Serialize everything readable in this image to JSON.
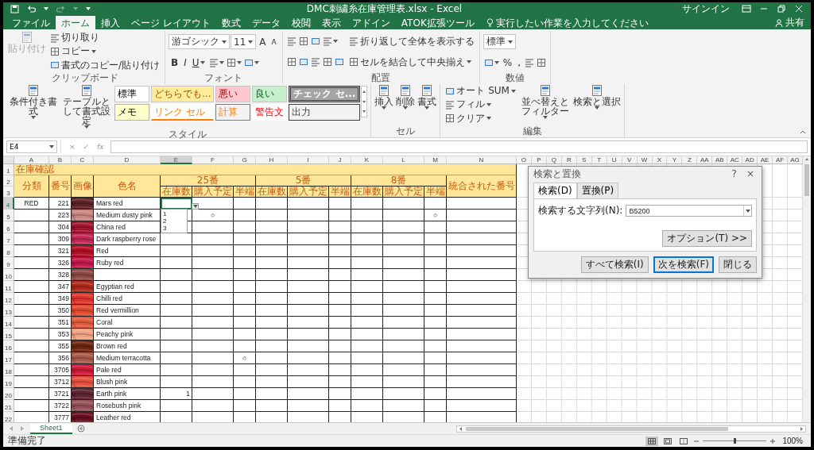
{
  "window": {
    "title": "DMC刺繍糸在庫管理表.xlsx - Excel",
    "sign_in": "サインイン",
    "share": "共有"
  },
  "tabs": [
    {
      "label": "ファイル",
      "selected": false
    },
    {
      "label": "ホーム",
      "selected": true
    },
    {
      "label": "挿入",
      "selected": false
    },
    {
      "label": "ページ レイアウト",
      "selected": false
    },
    {
      "label": "数式",
      "selected": false
    },
    {
      "label": "データ",
      "selected": false
    },
    {
      "label": "校閲",
      "selected": false
    },
    {
      "label": "表示",
      "selected": false
    },
    {
      "label": "アドイン",
      "selected": false
    },
    {
      "label": "ATOK拡張ツール",
      "selected": false
    }
  ],
  "tell_me": {
    "placeholder": "実行したい作業を入力してください"
  },
  "ribbon": {
    "groups": [
      {
        "label": "クリップボード",
        "columns": [
          {
            "kind": "big",
            "label": "貼り付け",
            "disabled": true
          },
          {
            "kind": "stack",
            "rows": [
              {
                "controls": [
                  {
                    "kind": "small",
                    "label": "切り取り"
                  }
                ]
              },
              {
                "controls": [
                  {
                    "kind": "small",
                    "label": "コピー",
                    "dropdown": true
                  }
                ]
              },
              {
                "controls": [
                  {
                    "kind": "small",
                    "label": "書式のコピー/貼り付け"
                  }
                ]
              }
            ]
          }
        ]
      },
      {
        "label": "フォント",
        "columns": [
          {
            "kind": "stack",
            "rows": [
              {
                "controls": [
                  {
                    "kind": "field",
                    "value": "游ゴシック"
                  },
                  {
                    "kind": "field",
                    "value": "11"
                  },
                  {
                    "kind": "text",
                    "label": "A"
                  },
                  {
                    "kind": "small-text",
                    "label": "A"
                  }
                ]
              },
              {
                "controls": [
                  {
                    "kind": "bold",
                    "label": "B"
                  },
                  {
                    "kind": "italic",
                    "label": "I"
                  },
                  {
                    "kind": "underline",
                    "label": "U",
                    "dropdown": true
                  },
                  {
                    "kind": "icon",
                    "dropdown": true
                  },
                  {
                    "kind": "icon",
                    "dropdown": true
                  },
                  {
                    "kind": "icon",
                    "dropdown": true
                  }
                ]
              }
            ]
          }
        ]
      },
      {
        "label": "配置",
        "columns": [
          {
            "kind": "stack",
            "rows": [
              {
                "controls": [
                  {
                    "kind": "icon"
                  },
                  {
                    "kind": "icon"
                  },
                  {
                    "kind": "icon"
                  },
                  {
                    "kind": "icon",
                    "dropdown": true
                  }
                ]
              },
              {
                "controls": [
                  {
                    "kind": "icon"
                  },
                  {
                    "kind": "icon"
                  },
                  {
                    "kind": "icon"
                  },
                  {
                    "kind": "icon"
                  },
                  {
                    "kind": "icon"
                  }
                ]
              }
            ]
          },
          {
            "kind": "stack",
            "rows": [
              {
                "controls": [
                  {
                    "kind": "small",
                    "label": "折り返して全体を表示する"
                  }
                ]
              },
              {
                "controls": [
                  {
                    "kind": "small",
                    "label": "セルを結合して中央揃え",
                    "dropdown": true
                  }
                ]
              }
            ]
          }
        ]
      },
      {
        "label": "数値",
        "columns": [
          {
            "kind": "stack",
            "rows": [
              {
                "controls": [
                  {
                    "kind": "field",
                    "value": "標準"
                  }
                ]
              },
              {
                "controls": [
                  {
                    "kind": "icon",
                    "dropdown": true
                  },
                  {
                    "kind": "text",
                    "label": "%"
                  },
                  {
                    "kind": "text",
                    "label": ","
                  },
                  {
                    "kind": "icon"
                  },
                  {
                    "kind": "icon"
                  }
                ]
              }
            ]
          }
        ]
      },
      {
        "label": "スタイル",
        "columns": [
          {
            "kind": "big",
            "label": "条件付き書式",
            "dropdown": true
          },
          {
            "kind": "big",
            "label": "テーブルとして書式設定",
            "dropdown": true
          },
          {
            "kind": "gallery",
            "cells": [
              {
                "kind": "normal",
                "label": "標準",
                "color": "#ffffff"
              },
              {
                "kind": "neutral",
                "label": "どちらでも...",
                "color": "#ffeb9c"
              },
              {
                "kind": "bad",
                "label": "悪い",
                "color": "#ffc7ce"
              },
              {
                "kind": "good",
                "label": "良い",
                "color": "#c6efce"
              },
              {
                "kind": "check",
                "label": "チェック セ...",
                "color": "#a5a5a5"
              },
              {
                "kind": "note",
                "label": "メモ",
                "color": "#ffffcc"
              },
              {
                "kind": "link",
                "label": "リンク セル",
                "color": "#ffffff"
              },
              {
                "kind": "calc",
                "label": "計算",
                "color": "#f2f2f2"
              },
              {
                "kind": "warning",
                "label": "警告文",
                "color": "#ffffff"
              },
              {
                "kind": "output",
                "label": "出力",
                "color": "#f2f2f2"
              }
            ]
          }
        ]
      },
      {
        "label": "セル",
        "columns": [
          {
            "kind": "big",
            "label": "挿入",
            "dropdown": true
          },
          {
            "kind": "big",
            "label": "削除",
            "dropdown": true
          },
          {
            "kind": "big",
            "label": "書式",
            "dropdown": true
          }
        ]
      },
      {
        "label": "編集",
        "columns": [
          {
            "kind": "stack",
            "rows": [
              {
                "controls": [
                  {
                    "kind": "small",
                    "label": "オート SUM",
                    "dropdown": true
                  }
                ]
              },
              {
                "controls": [
                  {
                    "kind": "small",
                    "label": "フィル",
                    "dropdown": true
                  }
                ]
              },
              {
                "controls": [
                  {
                    "kind": "small",
                    "label": "クリア",
                    "dropdown": true
                  }
                ]
              }
            ]
          },
          {
            "kind": "big",
            "label": "並べ替えとフィルター",
            "dropdown": true
          },
          {
            "kind": "big",
            "label": "検索と選択",
            "dropdown": true
          }
        ]
      }
    ]
  },
  "formula_bar": {
    "name_box": "E4",
    "buttons": [
      "×",
      "✓",
      "fx"
    ]
  },
  "sheet": {
    "columns": [
      {
        "label": "A",
        "selected": false
      },
      {
        "label": "B",
        "selected": false
      },
      {
        "label": "C",
        "selected": false
      },
      {
        "label": "D",
        "selected": false
      },
      {
        "label": "E",
        "selected": true
      },
      {
        "label": "F",
        "selected": false
      },
      {
        "label": "G",
        "selected": false
      },
      {
        "label": "H",
        "selected": false
      },
      {
        "label": "I",
        "selected": false
      },
      {
        "label": "J",
        "selected": false
      },
      {
        "label": "K",
        "selected": false
      },
      {
        "label": "L",
        "selected": false
      },
      {
        "label": "M",
        "selected": false
      },
      {
        "label": "N",
        "selected": false
      },
      {
        "label": "O",
        "selected": false
      },
      {
        "label": "P",
        "selected": false
      },
      {
        "label": "Q",
        "selected": false
      },
      {
        "label": "R",
        "selected": false
      },
      {
        "label": "S",
        "selected": false
      },
      {
        "label": "T",
        "selected": false
      },
      {
        "label": "U",
        "selected": false
      },
      {
        "label": "V",
        "selected": false
      },
      {
        "label": "W",
        "selected": false
      },
      {
        "label": "X",
        "selected": false
      },
      {
        "label": "Y",
        "selected": false
      },
      {
        "label": "Z",
        "selected": false
      },
      {
        "label": "AA",
        "selected": false
      },
      {
        "label": "AB",
        "selected": false
      },
      {
        "label": "AC",
        "selected": false
      },
      {
        "label": "AD",
        "selected": false
      },
      {
        "label": "AE",
        "selected": false
      },
      {
        "label": "AF",
        "selected": false
      },
      {
        "label": "AG",
        "selected": false
      }
    ],
    "row_headers": [
      {
        "label": "1",
        "selected": false
      },
      {
        "label": "2",
        "selected": false
      },
      {
        "label": "3",
        "selected": false
      },
      {
        "label": "4",
        "selected": true
      },
      {
        "label": "5",
        "selected": false
      },
      {
        "label": "6",
        "selected": false
      },
      {
        "label": "7",
        "selected": false
      },
      {
        "label": "8",
        "selected": false
      },
      {
        "label": "9",
        "selected": false
      },
      {
        "label": "10",
        "selected": false
      },
      {
        "label": "11",
        "selected": false
      },
      {
        "label": "12",
        "selected": false
      },
      {
        "label": "13",
        "selected": false
      },
      {
        "label": "14",
        "selected": false
      },
      {
        "label": "15",
        "selected": false
      },
      {
        "label": "16",
        "selected": false
      },
      {
        "label": "17",
        "selected": false
      },
      {
        "label": "18",
        "selected": false
      },
      {
        "label": "19",
        "selected": false
      },
      {
        "label": "20",
        "selected": false
      },
      {
        "label": "21",
        "selected": false
      },
      {
        "label": "22",
        "selected": false
      }
    ],
    "validation_list": {
      "items": [
        "1",
        "2",
        "3"
      ]
    }
  },
  "table": {
    "title": "在庫確認",
    "headers": [
      {
        "label": "分類"
      },
      {
        "label": "番号"
      },
      {
        "label": "画像"
      },
      {
        "label": "色名"
      },
      {
        "label": "25番",
        "sub": [
          "在庫数",
          "購入予定",
          "半端"
        ]
      },
      {
        "label": "5番",
        "sub": [
          "在庫数",
          "購入予定",
          "半端"
        ]
      },
      {
        "label": "8番",
        "sub": [
          "在庫数",
          "購入予定",
          "半端"
        ]
      },
      {
        "label": "統合された番号"
      }
    ],
    "rows": [
      {
        "category": "RED",
        "number": "221",
        "name": "Mars red"
      },
      {
        "number": "223",
        "name": "Medium dusty pink",
        "cells": {
          "25_purchase": "○",
          "8_odd": "○"
        }
      },
      {
        "number": "304",
        "name": "China red"
      },
      {
        "number": "309",
        "name": "Dark raspberry rose"
      },
      {
        "number": "321",
        "name": "Red"
      },
      {
        "number": "326",
        "name": "Ruby red"
      },
      {
        "number": "328"
      },
      {
        "number": "347",
        "name": "Egyptian red"
      },
      {
        "number": "349",
        "name": "Chilli red"
      },
      {
        "number": "350",
        "name": "Red vermillion"
      },
      {
        "number": "351",
        "name": "Coral"
      },
      {
        "number": "353",
        "name": "Peachy pink"
      },
      {
        "number": "355",
        "name": "Brown red"
      },
      {
        "number": "356",
        "name": "Medium terracotta",
        "cells": {
          "25_odd": "○"
        }
      },
      {
        "number": "3705",
        "name": "Pale red"
      },
      {
        "number": "3712",
        "name": "Blush pink"
      },
      {
        "number": "3721",
        "name": "Earth pink",
        "cells": {
          "25_stock": "1"
        }
      },
      {
        "number": "3722",
        "name": "Rosebush pink"
      },
      {
        "number": "3777",
        "name": "Leather red"
      }
    ]
  },
  "dialog": {
    "title": "検索と置換",
    "help": "?",
    "close": "×",
    "tabs": [
      {
        "label": "検索(D)",
        "selected": true
      },
      {
        "label": "置換(P)",
        "selected": false
      }
    ],
    "field_label": "検索する文字列(N):",
    "value": "B5200",
    "options_button": "オプション(T) >>",
    "buttons": [
      {
        "label": "すべて検索(I)",
        "default": false
      },
      {
        "label": "次を検索(F)",
        "default": true
      },
      {
        "label": "閉じる",
        "default": false
      }
    ]
  },
  "sheet_tabs": [
    {
      "label": "Sheet1",
      "selected": true
    }
  ],
  "status_bar": {
    "status": "準備完了",
    "views": [
      {
        "kind": "normal",
        "selected": true
      },
      {
        "kind": "layout",
        "selected": false
      },
      {
        "kind": "break",
        "selected": false
      }
    ],
    "zoom": {
      "level": 0.5,
      "reading": "100%"
    }
  }
}
